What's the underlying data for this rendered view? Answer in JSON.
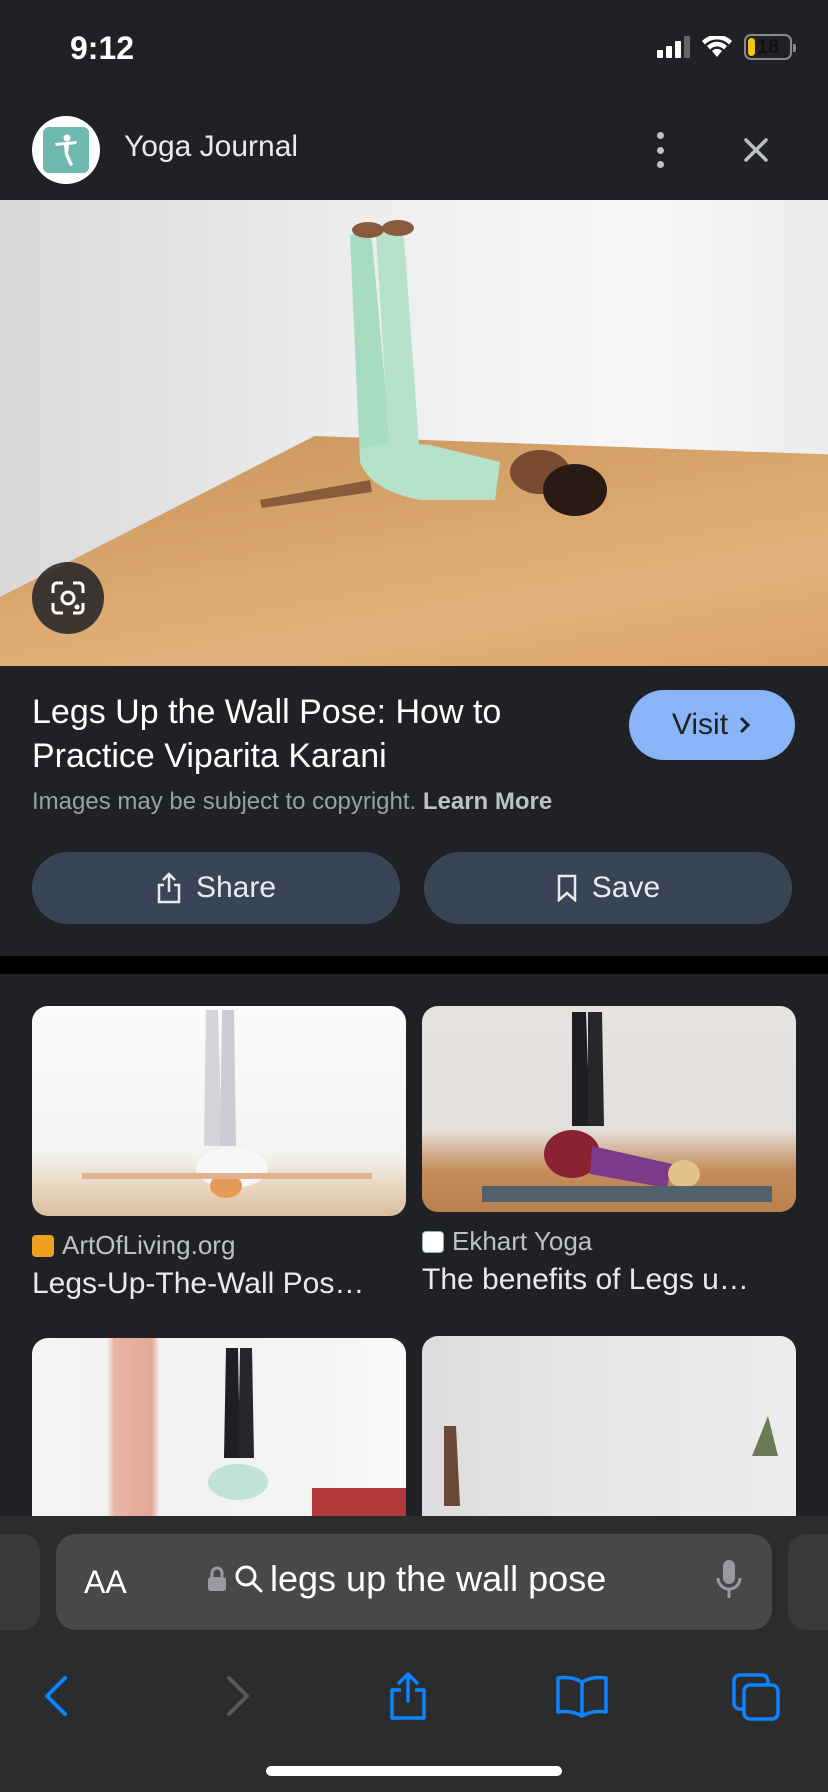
{
  "status_bar": {
    "time": "9:12",
    "battery": "18",
    "battery_level": 0.18
  },
  "header": {
    "site_name": "Yoga Journal"
  },
  "result": {
    "title": "Legs Up the Wall Pose: How to Practice Viparita Karani",
    "visit_label": "Visit",
    "copyright_text": "Images may be subject to copyright.",
    "learn_more": "Learn More",
    "share_label": "Share",
    "save_label": "Save"
  },
  "related": [
    {
      "source": "ArtOfLiving.org",
      "caption": "Legs-Up-The-Wall Pos…",
      "favicon_color": "#f0a020"
    },
    {
      "source": "Ekhart Yoga",
      "caption": "The benefits of Legs u…",
      "favicon_color": "#ffffff"
    }
  ],
  "browser": {
    "query": "legs up the wall pose",
    "aa_label": "AA"
  },
  "colors": {
    "accent": "#8ab4f8",
    "ios_blue": "#0a84ff",
    "button_bg": "#394457"
  }
}
